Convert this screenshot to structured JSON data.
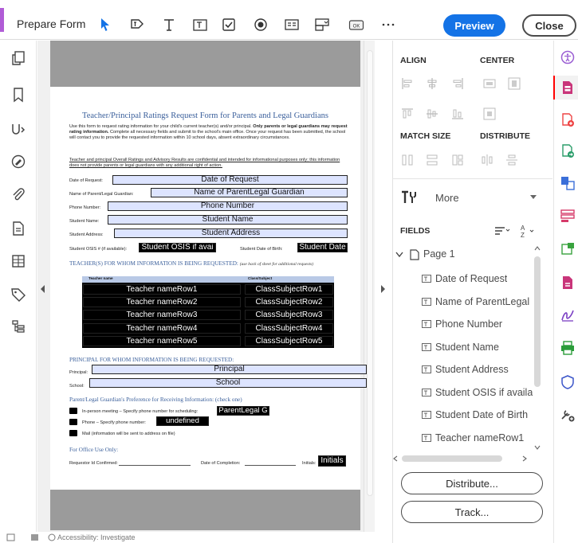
{
  "toolbar": {
    "title": "Prepare Form",
    "preview_label": "Preview",
    "close_label": "Close",
    "tools": [
      "select-pointer-icon",
      "text-edit-icon",
      "text-icon",
      "text-field-icon",
      "checkbox-icon",
      "radio-button-icon",
      "list-box-icon",
      "dropdown-icon",
      "ok-button-icon",
      "more-icon"
    ]
  },
  "left_rail": [
    "copy-pages-icon",
    "bookmark-icon",
    "attach-sign-icon",
    "edit-icon",
    "paperclip-icon",
    "page-icon",
    "layers-icon",
    "tag-icon",
    "structure-icon"
  ],
  "document": {
    "title": "Teacher/Principal Ratings Request Form for Parents and Legal Guardians",
    "intro_a": "Use this form to request rating information for your child's current teacher(s) and/or principal.",
    "intro_b": "Only parents or legal guardians may request rating information.",
    "intro_c": "Complete all necessary fields and submit to the school's main office. Once your request has been submitted, the school will contact you to provide the requested information within 10 school days, absent extraordinary circumstances.",
    "notice": "Teacher and principal Overall Ratings and Advisory Results are confidential and intended for informational purposes only; this information does not provide parents or legal guardians with any additional right of action.",
    "labels": {
      "date": "Date of Request:",
      "parent": "Name of Parent/Legal Guardian:",
      "phone": "Phone Number:",
      "student_name": "Student Name:",
      "student_address": "Student Address:",
      "osis": "Student OSIS # (if available):",
      "dob": "Student Date of Birth:",
      "principal": "Principal:",
      "school": "School:"
    },
    "teachers_heading": "TEACHER(S) FOR WHOM INFORMATION IS BEING REQUESTED:",
    "teachers_note": "(use back of sheet for additional requests)",
    "table_col_teacher": "Teacher name",
    "table_col_class": "Class/Subject",
    "principal_heading": "PRINCIPAL FOR WHOM INFORMATION IS BEING REQUESTED:",
    "preference_heading": "Parent/Legal Guardian's Preference for Receiving Information: (check one)",
    "pref_inperson": "In-person meeting – Specify phone number for scheduling:",
    "pref_phone": "Phone – Specify phone number:",
    "pref_mail": "Mail (information will be sent to address on file)",
    "office_heading": "For Office Use Only:",
    "office_requestor": "Requestor Id Confirmed:",
    "office_completion": "Date of Completion:",
    "office_initials": "Initials:",
    "fields": {
      "date": "Date of Request",
      "parent": "Name of ParentLegal Guardian",
      "phone": "Phone Number",
      "student_name": "Student Name",
      "student_address": "Student Address",
      "osis": "Student OSIS  if avai",
      "dob": "Student Date",
      "principal": "Principal",
      "school": "School",
      "inperson_phone": "ParentLegal G",
      "phone_number": "undefined",
      "initials": "Initials"
    },
    "teacher_rows": [
      "Teacher nameRow1",
      "Teacher nameRow2",
      "Teacher nameRow3",
      "Teacher nameRow4",
      "Teacher nameRow5"
    ],
    "class_rows": [
      "ClassSubjectRow1",
      "ClassSubjectRow2",
      "ClassSubjectRow3",
      "ClassSubjectRow4",
      "ClassSubjectRow5"
    ]
  },
  "panel": {
    "align": "ALIGN",
    "center": "CENTER",
    "match_size": "MATCH SIZE",
    "distribute": "DISTRIBUTE",
    "more": "More",
    "fields": "FIELDS",
    "page": "Page 1",
    "field_items": [
      "Date of Request",
      "Name of ParentLegal G",
      "Phone Number",
      "Student Name",
      "Student Address",
      "Student OSIS  if availal",
      "Student Date of Birth",
      "Teacher nameRow1"
    ],
    "distribute_btn": "Distribute...",
    "track_btn": "Track..."
  },
  "right_rail": [
    "accessibility-icon",
    "create-pdf-icon",
    "export-pdf-icon",
    "combine-files-icon",
    "organize-pages-icon",
    "edit-pdf-icon",
    "request-signature-icon",
    "scan-ocr-icon",
    "fill-sign-icon",
    "print-production-icon",
    "protect-icon",
    "more-tools-icon"
  ],
  "status": {
    "text": "Accessibility: Investigate"
  },
  "colors": {
    "accent": "#b05cd6",
    "preview": "#1473e6",
    "field_fill": "#dde4ff",
    "heading_blue": "#3a5f9b"
  }
}
